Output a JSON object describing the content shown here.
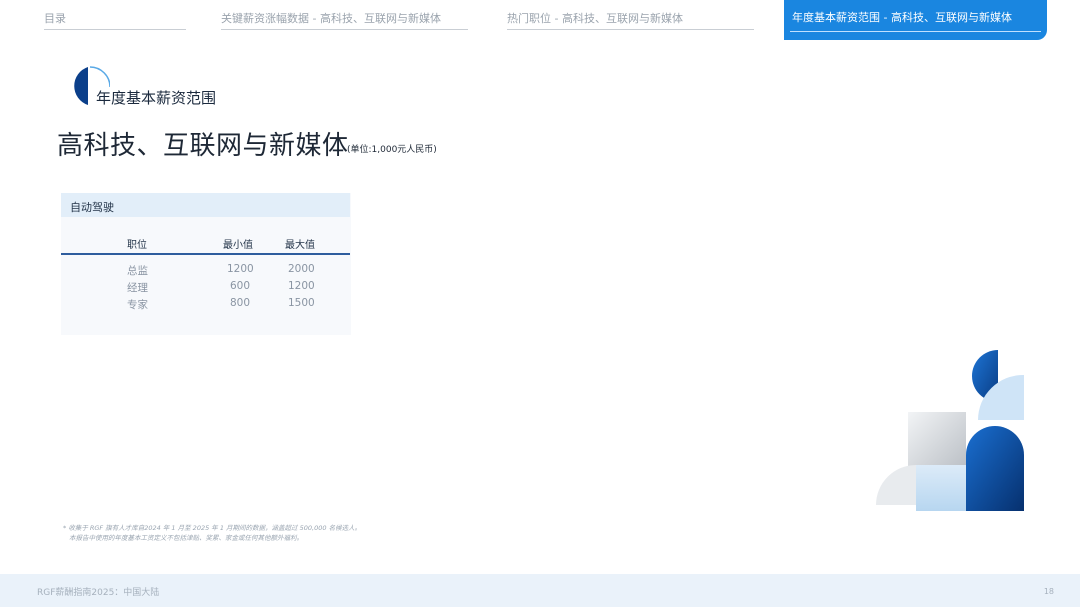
{
  "nav": {
    "tabs": [
      {
        "label": "目录"
      },
      {
        "label": "关键薪资涨幅数据 - 高科技、互联网与新媒体"
      },
      {
        "label": "热门职位 - 高科技、互联网与新媒体"
      },
      {
        "label": "年度基本薪资范围 - 高科技、互联网与新媒体"
      }
    ],
    "active_index": 3
  },
  "section_label": "年度基本薪资范围",
  "page_title": "高科技、互联网与新媒体",
  "unit_note": "(单位:1,000元人民币)",
  "card": {
    "title": "自动驾驶",
    "columns": [
      "职位",
      "最小值",
      "最大值"
    ],
    "rows": [
      [
        "总监",
        "1200",
        "2000"
      ],
      [
        "经理",
        "600",
        "1200"
      ],
      [
        "专家",
        "800",
        "1500"
      ]
    ]
  },
  "footnote": {
    "line1": "* 收集于 RGF 旗有人才库自2024 年 1 月至 2025 年 1 月期间的数据，涵盖超过 500,000 名候选人。",
    "line2": "本报告中使用的年度基本工资定义不包括津贴、奖累、家金或任何其他额外福利。"
  },
  "footer": {
    "text": "RGF薪酬指南2025：中国大陆",
    "page": "18"
  },
  "colors": {
    "accent": "#1a86e0",
    "navy": "#0b3f8a",
    "light_blue": "#e2eef9"
  }
}
